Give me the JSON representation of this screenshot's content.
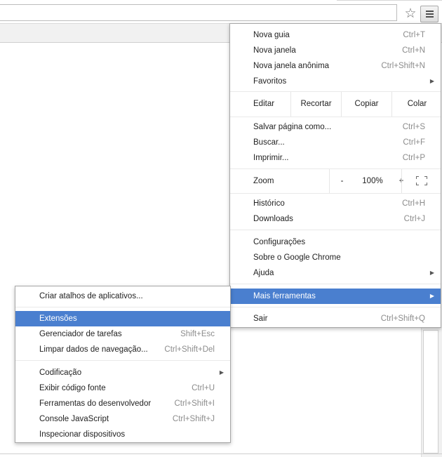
{
  "toolbar": {
    "star_icon": "star-icon",
    "menu_icon": "hamburger-icon"
  },
  "main_menu": {
    "group1": [
      {
        "label": "Nova guia",
        "shortcut": "Ctrl+T"
      },
      {
        "label": "Nova janela",
        "shortcut": "Ctrl+N"
      },
      {
        "label": "Nova janela anônima",
        "shortcut": "Ctrl+Shift+N"
      },
      {
        "label": "Favoritos",
        "shortcut": ""
      }
    ],
    "edit": {
      "label": "Editar",
      "cut": "Recortar",
      "copy": "Copiar",
      "paste": "Colar"
    },
    "group2": [
      {
        "label": "Salvar página como...",
        "shortcut": "Ctrl+S"
      },
      {
        "label": "Buscar...",
        "shortcut": "Ctrl+F"
      },
      {
        "label": "Imprimir...",
        "shortcut": "Ctrl+P"
      }
    ],
    "zoom": {
      "label": "Zoom",
      "minus": "-",
      "value": "100%",
      "plus": "+"
    },
    "group3": [
      {
        "label": "Histórico",
        "shortcut": "Ctrl+H"
      },
      {
        "label": "Downloads",
        "shortcut": "Ctrl+J"
      }
    ],
    "group4": [
      {
        "label": "Configurações",
        "shortcut": ""
      },
      {
        "label": "Sobre o Google Chrome",
        "shortcut": ""
      },
      {
        "label": "Ajuda",
        "shortcut": ""
      }
    ],
    "more_tools": {
      "label": "Mais ferramentas"
    },
    "exit": {
      "label": "Sair",
      "shortcut": "Ctrl+Shift+Q"
    }
  },
  "sub_menu": {
    "group1": [
      {
        "label": "Criar atalhos de aplicativos...",
        "shortcut": ""
      }
    ],
    "group2": [
      {
        "label": "Extensões",
        "shortcut": ""
      },
      {
        "label": "Gerenciador de tarefas",
        "shortcut": "Shift+Esc"
      },
      {
        "label": "Limpar dados de navegação...",
        "shortcut": "Ctrl+Shift+Del"
      }
    ],
    "group3": [
      {
        "label": "Codificação",
        "shortcut": ""
      },
      {
        "label": "Exibir código fonte",
        "shortcut": "Ctrl+U"
      },
      {
        "label": "Ferramentas do desenvolvedor",
        "shortcut": "Ctrl+Shift+I"
      },
      {
        "label": "Console JavaScript",
        "shortcut": "Ctrl+Shift+J"
      },
      {
        "label": "Inspecionar dispositivos",
        "shortcut": ""
      }
    ]
  },
  "colors": {
    "highlight": "#4a7fcf",
    "shortcut_text": "#8c8c8c"
  }
}
